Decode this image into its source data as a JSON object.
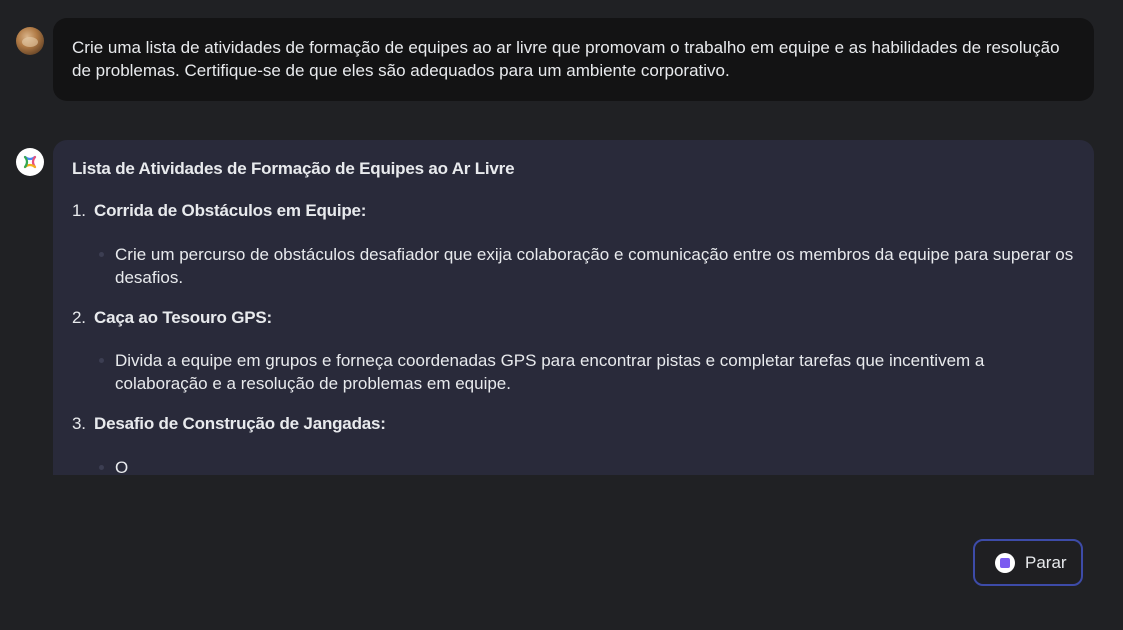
{
  "user_message": {
    "text": "Crie uma lista de atividades de formação de equipes ao ar livre que promovam o trabalho em equipe e as habilidades de resolução de problemas. Certifique-se de que eles são adequados para um ambiente corporativo."
  },
  "response": {
    "title": "Lista de Atividades de Formação de Equipes ao Ar Livre",
    "items": [
      {
        "number": "1.",
        "heading": "Corrida de Obstáculos em Equipe:",
        "detail": "Crie um percurso de obstáculos desafiador que exija colaboração e comunicação entre os membros da equipe para superar os desafios."
      },
      {
        "number": "2.",
        "heading": "Caça ao Tesouro GPS:",
        "detail": "Divida a equipe em grupos e forneça coordenadas GPS para encontrar pistas e completar tarefas que incentivem a colaboração e a resolução de problemas em equipe."
      },
      {
        "number": "3.",
        "heading": "Desafio de Construção de Jangadas:",
        "detail": "O"
      }
    ]
  },
  "controls": {
    "stop_label": "Parar"
  },
  "icons": {
    "user_avatar": "user-avatar",
    "assistant_logo": "assistant-logo-icon",
    "stop": "stop-icon"
  },
  "colors": {
    "background": "#202124",
    "user_bubble": "#131314",
    "assistant_bubble": "#292a3a",
    "stop_border": "#3d4ba8",
    "stop_accent": "#7b5cf0"
  }
}
